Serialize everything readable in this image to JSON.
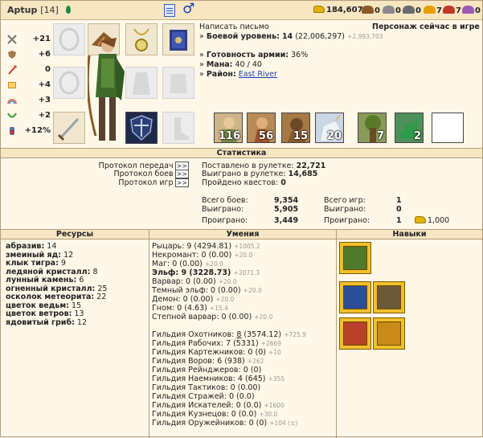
{
  "header": {
    "nickname": "Aptup",
    "level_badge": "[14]",
    "resources": [
      {
        "name": "gold",
        "value": "184,607",
        "color": "#e6b400"
      },
      {
        "name": "wood",
        "value": "0",
        "color": "#8b5a2b"
      },
      {
        "name": "ore",
        "value": "0",
        "color": "#8a8a8a"
      },
      {
        "name": "mercury",
        "value": "0",
        "color": "#6b6b6b"
      },
      {
        "name": "sulfur",
        "value": "7",
        "color": "#e8a000"
      },
      {
        "name": "crystal",
        "value": "7",
        "color": "#c0392b"
      },
      {
        "name": "gems",
        "value": "0",
        "color": "#9b59b6"
      }
    ]
  },
  "stats": [
    {
      "icon": "sword-icon",
      "value": "+21"
    },
    {
      "icon": "shield-icon",
      "value": "+6"
    },
    {
      "icon": "wand-icon",
      "value": "0"
    },
    {
      "icon": "book-icon",
      "value": "+4"
    },
    {
      "icon": "rainbow-icon",
      "value": "+3"
    },
    {
      "icon": "laurel-icon",
      "value": "+2"
    },
    {
      "icon": "potion-icon",
      "value": "+12%"
    }
  ],
  "info": {
    "write_letter": "Написать письмо",
    "in_game": "Персонаж сейчас в игре",
    "combat_level_label": "Боевой уровень:",
    "combat_level_value": "14",
    "combat_level_exp": "(22,006,297)",
    "combat_level_next": "+2,993,703",
    "army_ready_label": "Готовность армии:",
    "army_ready_value": "36%",
    "mana_label": "Мана:",
    "mana_value": "40 / 40",
    "district_label": "Район:",
    "district_value": "East River"
  },
  "army": [
    {
      "count": "116",
      "color": "#cdb48a"
    },
    {
      "count": "56",
      "color": "#b58b5a"
    },
    {
      "count": "15",
      "color": "#a57a45"
    },
    {
      "count": "20",
      "color": "#c9d6e6"
    },
    {
      "count": "7",
      "color": "#8a9a5a"
    },
    {
      "count": "2",
      "color": "#4f8f5a"
    },
    {
      "count": "",
      "color": "#ffffff"
    }
  ],
  "statistics": {
    "title": "Статистика",
    "protocols": [
      {
        "label": "Протокол передач",
        "btn": ">>"
      },
      {
        "label": "Протокол боев",
        "btn": ">>"
      },
      {
        "label": "Протокол игр",
        "btn": ">>"
      }
    ],
    "roulette_bet_label": "Поставлено в рулетке:",
    "roulette_bet": "22,721",
    "roulette_won_label": "Выиграно в рулетке:",
    "roulette_won": "14,685",
    "quests_label": "Пройдено квестов:",
    "quests": "0",
    "total_battles_label": "Всего боев:",
    "total_battles": "9,354",
    "battles_won_label": "Выиграно:",
    "battles_won": "5,905",
    "battles_lost_label": "Проиграно:",
    "battles_lost": "3,449",
    "total_games_label": "Всего игр:",
    "total_games": "1",
    "games_won_label": "Выиграно:",
    "games_won": "0",
    "games_lost_label": "Проиграно:",
    "games_lost": "1",
    "games_gold": "1,000"
  },
  "columns": {
    "resources": "Ресурсы",
    "skills": "Умения",
    "abilities": "Навыки"
  },
  "resources_list": [
    {
      "name": "абразив:",
      "value": "14"
    },
    {
      "name": "змеиный яд:",
      "value": "12"
    },
    {
      "name": "клык тигра:",
      "value": "9"
    },
    {
      "name": "ледяной кристалл:",
      "value": "8"
    },
    {
      "name": "лунный камень:",
      "value": "6"
    },
    {
      "name": "огненный кристалл:",
      "value": "25"
    },
    {
      "name": "осколок метеорита:",
      "value": "22"
    },
    {
      "name": "цветок ведьм:",
      "value": "15"
    },
    {
      "name": "цветок ветров:",
      "value": "13"
    },
    {
      "name": "ядовитый гриб:",
      "value": "12"
    }
  ],
  "skills_factions": [
    {
      "text": "Рыцарь: 9 (4294.81)",
      "plus": "+1005.2",
      "bold": false
    },
    {
      "text": "Некромант: 0 (0.00)",
      "plus": "+20.0",
      "bold": false
    },
    {
      "text": "Маг: 0 (0.00)",
      "plus": "+20.0",
      "bold": false
    },
    {
      "text": "Эльф: 9 (3228.73)",
      "plus": "+2071.3",
      "bold": true
    },
    {
      "text": "Варвар: 0 (0.00)",
      "plus": "+20.0",
      "bold": false
    },
    {
      "text": "Темный эльф: 0 (0.00)",
      "plus": "+20.0",
      "bold": false
    },
    {
      "text": "Демон: 0 (0.00)",
      "plus": "+20.0",
      "bold": false
    },
    {
      "text": "Гном: 0 (4.63)",
      "plus": "+15.4",
      "bold": false
    },
    {
      "text": "Степной варвар: 0 (0.00)",
      "plus": "+20.0",
      "bold": false
    }
  ],
  "skills_guilds": [
    {
      "name": "Гильдия Охотников:",
      "level": "8",
      "rest": "(3574.12)",
      "plus": "+725.9",
      "underline": true
    },
    {
      "name": "Гильдия Рабочих:",
      "level": "7",
      "rest": "(5331)",
      "plus": "+2669",
      "underline": false
    },
    {
      "name": "Гильдия Картежников:",
      "level": "0",
      "rest": "(0)",
      "plus": "+10",
      "underline": false
    },
    {
      "name": "Гильдия Воров:",
      "level": "6",
      "rest": "(938)",
      "plus": "+262",
      "underline": false
    },
    {
      "name": "Гильдия Рейнджеров:",
      "level": "0",
      "rest": "(0)",
      "plus": "",
      "underline": false
    },
    {
      "name": "Гильдия Наемников:",
      "level": "4",
      "rest": "(645)",
      "plus": "+355",
      "underline": false
    },
    {
      "name": "Гильдия Тактиков:",
      "level": "0",
      "rest": "(0.00)",
      "plus": "",
      "underline": false
    },
    {
      "name": "Гильдия Стражей:",
      "level": "0",
      "rest": "(0.0)",
      "plus": "",
      "underline": false
    },
    {
      "name": "Гильдия Искателей:",
      "level": "0",
      "rest": "(0.0)",
      "plus": "+1600",
      "underline": false
    },
    {
      "name": "Гильдия Кузнецов:",
      "level": "0",
      "rest": "(0.0)",
      "plus": "+30.0",
      "underline": false
    },
    {
      "name": "Гильдия Оружейников:",
      "level": "0",
      "rest": "(0)",
      "plus": "+104 (±)",
      "underline": false
    }
  ]
}
